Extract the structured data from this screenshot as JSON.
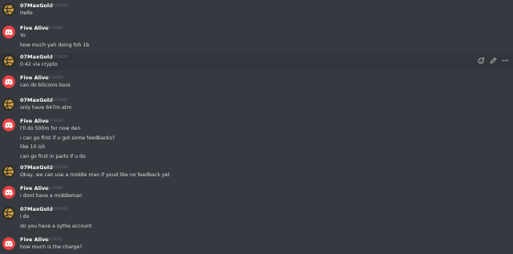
{
  "messages": [
    {
      "author": "07MaxGold",
      "time": "10/17/2020",
      "lines": [
        "Hello"
      ]
    },
    {
      "author": "Five Alive",
      "time": "10/17/2020",
      "lines": [
        "Yo",
        "how much yah doing foh 1b"
      ]
    },
    {
      "author": "07MaxGold",
      "time": "10/17/2020",
      "lines": [
        "0.42 via crypto"
      ],
      "hovered": true
    },
    {
      "author": "Five Alive",
      "time": "10/17/2020",
      "lines": [
        "can do bitcoins boss"
      ]
    },
    {
      "author": "07MaxGold",
      "time": "10/17/2020",
      "lines": [
        "only have 647m atm"
      ]
    },
    {
      "author": "Five Alive",
      "time": "10/17/2020",
      "lines": [
        "I'll do 500m for now den",
        "i can go first if u got some feedbacks?",
        "like 10 ish",
        "can go first in parts if u do"
      ]
    },
    {
      "author": "07MaxGold",
      "time": "10/17/2020",
      "lines": [
        "Okay, we can use a middle man if youd like no feedback yet"
      ]
    },
    {
      "author": "Five Alive",
      "time": "10/17/2020",
      "lines": [
        "i dont have a middleman"
      ]
    },
    {
      "author": "07MaxGold",
      "time": "10/17/2020",
      "lines": [
        "i do",
        "do you have a sythe account"
      ]
    },
    {
      "author": "Five Alive",
      "time": "10/17/2020",
      "lines": [
        "how much is the charge?"
      ]
    }
  ],
  "hover_actions": [
    {
      "icon": "add-reaction-icon"
    },
    {
      "icon": "edit-pencil-icon"
    },
    {
      "icon": "more-options-icon"
    }
  ],
  "colors": {
    "background": "#36393f",
    "hover_background": "#32353b",
    "username": "#ffffff",
    "message_text": "#dcddde",
    "timestamp": "#72767d",
    "discord_avatar": "#ed4245",
    "volleyball_avatar": "#2b2a1c"
  }
}
